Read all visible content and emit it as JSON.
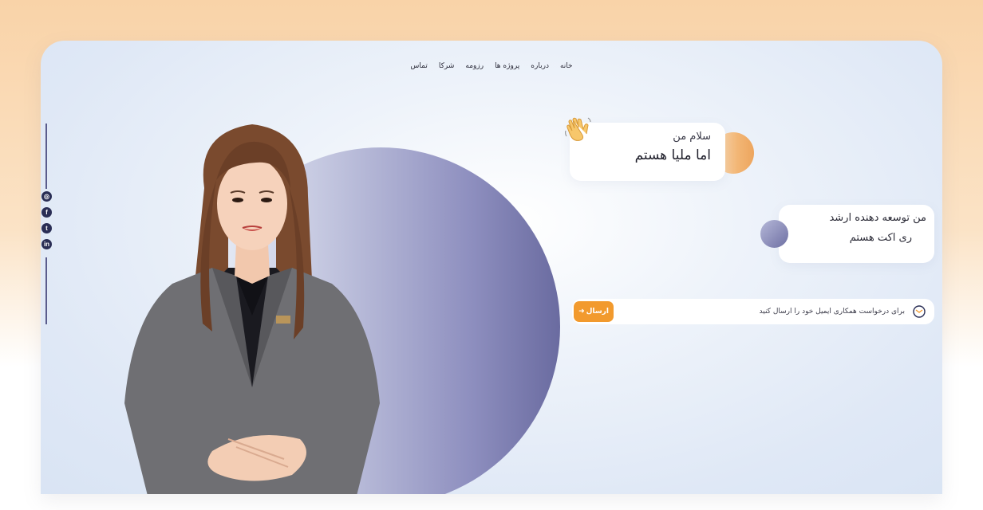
{
  "nav": {
    "items": [
      "خانه",
      "درباره",
      "پروژه ها",
      "رزومه",
      "شرکا",
      "تماس"
    ]
  },
  "social": {
    "icons": [
      "instagram-icon",
      "facebook-icon",
      "twitter-icon",
      "linkedin-icon"
    ],
    "glyphs": [
      "◎",
      "f",
      "t",
      "in"
    ]
  },
  "hero": {
    "greeting_line1": "سلام من",
    "greeting_line2": "اما ملیا هستم",
    "role_line1": "من توسعه دهنده ارشد",
    "role_line2": "ری اکت هستم",
    "email_prompt": "برای درخواست همکاری ایمیل خود را ارسال کنید",
    "send_label": "ارسال",
    "send_arrow": "➜"
  },
  "colors": {
    "accent_orange": "#f29a2e",
    "accent_purple": "#6a6ba0",
    "social_dark": "#2a2e55"
  }
}
